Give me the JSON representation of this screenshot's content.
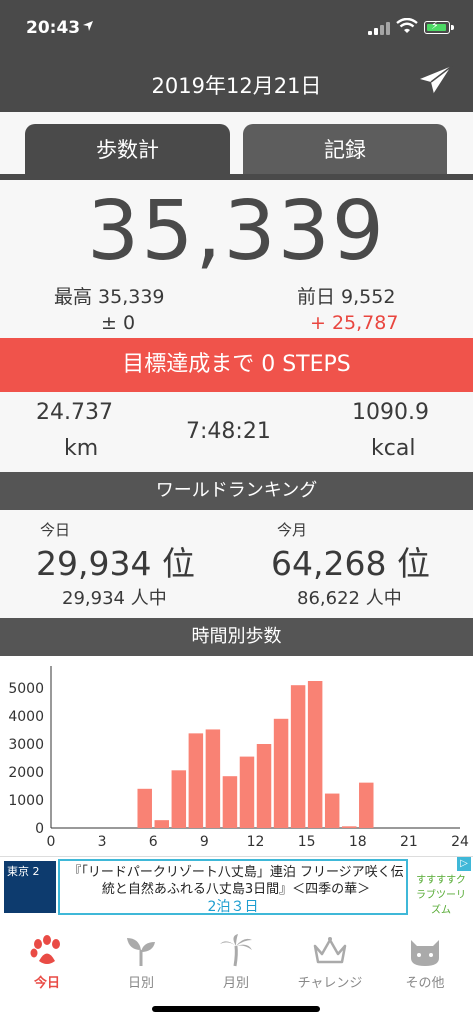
{
  "status_bar": {
    "time": "20:43",
    "location_icon": "location-arrow-icon"
  },
  "header": {
    "date": "2019年12月21日",
    "send_icon": "paper-plane-icon"
  },
  "tabs": [
    {
      "label": "歩数計",
      "active": true
    },
    {
      "label": "記録",
      "active": false
    }
  ],
  "steps": {
    "total": "35,339",
    "best": "最高 35,339",
    "best_diff": "± 0",
    "prev_day": "前日 9,552",
    "prev_diff": "+ 25,787"
  },
  "goal_banner": "目標達成まで 0 STEPS",
  "metrics": {
    "distance_value": "24.737",
    "distance_unit": "km",
    "time": "7:48:21",
    "calories_value": "1090.9",
    "calories_unit": "kcal"
  },
  "world_ranking": {
    "title": "ワールドランキング",
    "today_label": "今日",
    "today_rank": "29,934 位",
    "today_total": "29,934 人中",
    "month_label": "今月",
    "month_rank": "64,268 位",
    "month_total": "86,622 人中"
  },
  "hourly": {
    "title": "時間別歩数"
  },
  "chart_data": {
    "type": "bar",
    "title": "時間別歩数",
    "x": [
      5.5,
      6.5,
      7.5,
      8.5,
      9.5,
      10.5,
      11.5,
      12.5,
      13.5,
      14.5,
      15.5,
      16.5,
      17.5,
      18.5
    ],
    "values": [
      1400,
      280,
      2060,
      3380,
      3520,
      1850,
      2550,
      3000,
      3900,
      5100,
      5250,
      1230,
      60,
      1620
    ],
    "xlim": [
      0,
      24
    ],
    "ylim": [
      0,
      5500
    ],
    "x_ticks": [
      "0",
      "3",
      "6",
      "9",
      "12",
      "15",
      "18",
      "21",
      "24"
    ],
    "y_ticks": [
      "0",
      "1000",
      "2000",
      "3000",
      "4000",
      "5000"
    ],
    "color": "#f98274",
    "grid": false
  },
  "ad": {
    "thumb_text": "東京\n2",
    "line1": "『「リードパークリゾート八丈島」連泊 フリージア咲く伝統と自然あふれる八丈島3日間』＜四季の華＞",
    "price": "2泊３日",
    "logo_text": "すすすすクラブツーリズム"
  },
  "nav": [
    {
      "label": "今日",
      "icon": "paw-icon",
      "active": true
    },
    {
      "label": "日別",
      "icon": "sprout-icon",
      "active": false
    },
    {
      "label": "月別",
      "icon": "palm-tree-icon",
      "active": false
    },
    {
      "label": "チャレンジ",
      "icon": "crown-icon",
      "active": false
    },
    {
      "label": "その他",
      "icon": "cat-icon",
      "active": false
    }
  ],
  "colors": {
    "accent": "#f0534b",
    "header": "#4a4a4a",
    "bar": "#f98274"
  }
}
